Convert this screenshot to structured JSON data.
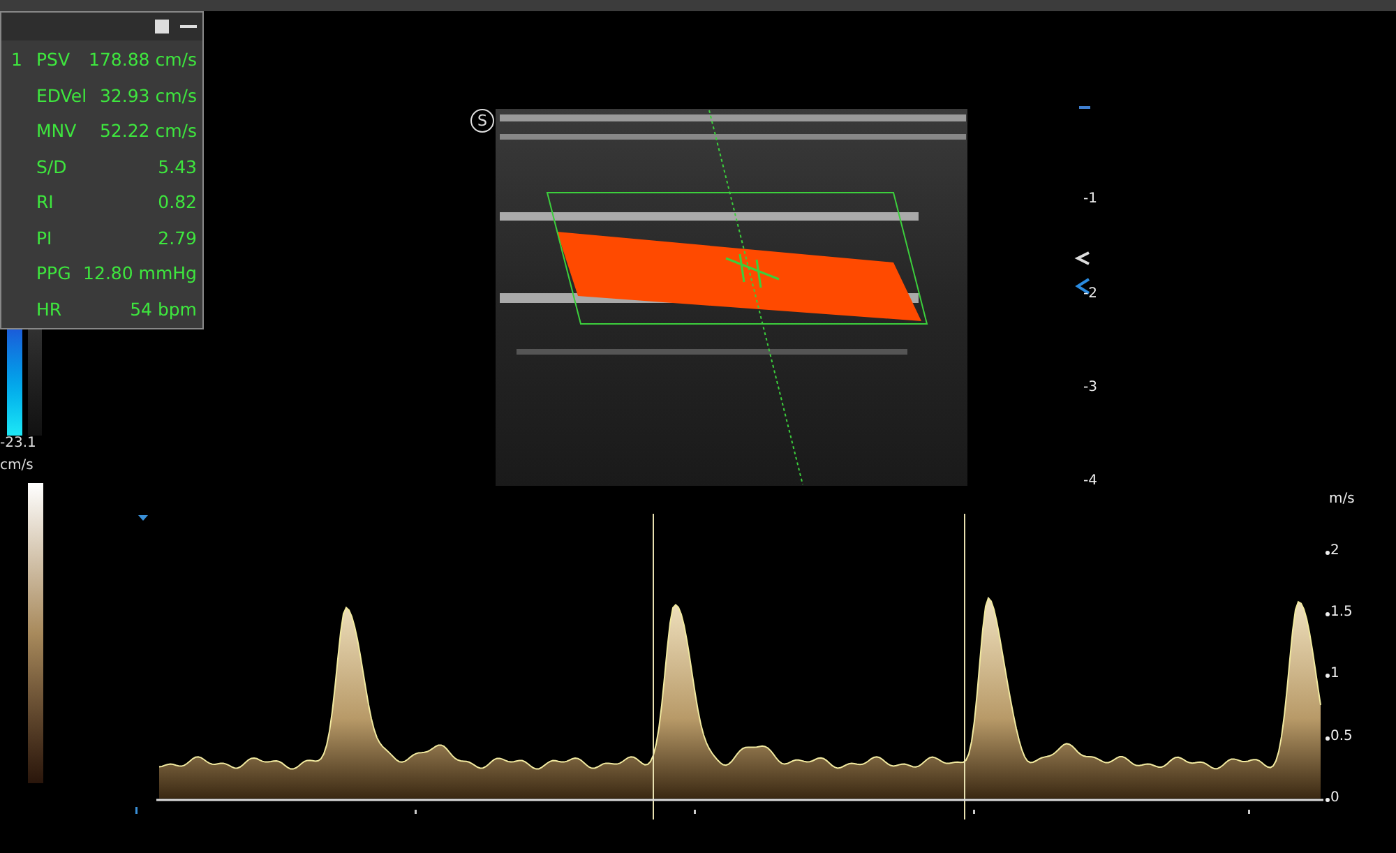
{
  "measurements": {
    "index": "1",
    "rows": [
      {
        "label": "PSV",
        "value": "178.88 cm/s"
      },
      {
        "label": "EDVel",
        "value": "32.93 cm/s"
      },
      {
        "label": "MNV",
        "value": "52.22 cm/s"
      },
      {
        "label": "S/D",
        "value": "5.43"
      },
      {
        "label": "RI",
        "value": "0.82"
      },
      {
        "label": "PI",
        "value": "2.79"
      },
      {
        "label": "PPG",
        "value": "12.80 mmHg"
      },
      {
        "label": "HR",
        "value": "54 bpm"
      }
    ]
  },
  "color_scale": {
    "min_label": "-23.1",
    "unit": "cm/s"
  },
  "image": {
    "orientation_mark": "S"
  },
  "depth_scale": {
    "ticks": [
      "-1",
      "-2",
      "-3",
      "-4"
    ]
  },
  "spectrum": {
    "unit": "m/s",
    "ticks": [
      "2",
      "1.5",
      "1",
      "0.5",
      "0"
    ]
  }
}
